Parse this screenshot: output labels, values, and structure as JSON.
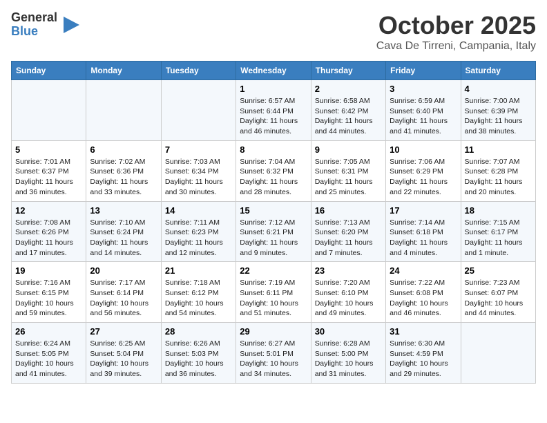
{
  "header": {
    "logo_general": "General",
    "logo_blue": "Blue",
    "month_title": "October 2025",
    "location": "Cava De Tirreni, Campania, Italy"
  },
  "columns": [
    "Sunday",
    "Monday",
    "Tuesday",
    "Wednesday",
    "Thursday",
    "Friday",
    "Saturday"
  ],
  "weeks": [
    [
      {
        "day": "",
        "info": ""
      },
      {
        "day": "",
        "info": ""
      },
      {
        "day": "",
        "info": ""
      },
      {
        "day": "1",
        "info": "Sunrise: 6:57 AM\nSunset: 6:44 PM\nDaylight: 11 hours and 46 minutes."
      },
      {
        "day": "2",
        "info": "Sunrise: 6:58 AM\nSunset: 6:42 PM\nDaylight: 11 hours and 44 minutes."
      },
      {
        "day": "3",
        "info": "Sunrise: 6:59 AM\nSunset: 6:40 PM\nDaylight: 11 hours and 41 minutes."
      },
      {
        "day": "4",
        "info": "Sunrise: 7:00 AM\nSunset: 6:39 PM\nDaylight: 11 hours and 38 minutes."
      }
    ],
    [
      {
        "day": "5",
        "info": "Sunrise: 7:01 AM\nSunset: 6:37 PM\nDaylight: 11 hours and 36 minutes."
      },
      {
        "day": "6",
        "info": "Sunrise: 7:02 AM\nSunset: 6:36 PM\nDaylight: 11 hours and 33 minutes."
      },
      {
        "day": "7",
        "info": "Sunrise: 7:03 AM\nSunset: 6:34 PM\nDaylight: 11 hours and 30 minutes."
      },
      {
        "day": "8",
        "info": "Sunrise: 7:04 AM\nSunset: 6:32 PM\nDaylight: 11 hours and 28 minutes."
      },
      {
        "day": "9",
        "info": "Sunrise: 7:05 AM\nSunset: 6:31 PM\nDaylight: 11 hours and 25 minutes."
      },
      {
        "day": "10",
        "info": "Sunrise: 7:06 AM\nSunset: 6:29 PM\nDaylight: 11 hours and 22 minutes."
      },
      {
        "day": "11",
        "info": "Sunrise: 7:07 AM\nSunset: 6:28 PM\nDaylight: 11 hours and 20 minutes."
      }
    ],
    [
      {
        "day": "12",
        "info": "Sunrise: 7:08 AM\nSunset: 6:26 PM\nDaylight: 11 hours and 17 minutes."
      },
      {
        "day": "13",
        "info": "Sunrise: 7:10 AM\nSunset: 6:24 PM\nDaylight: 11 hours and 14 minutes."
      },
      {
        "day": "14",
        "info": "Sunrise: 7:11 AM\nSunset: 6:23 PM\nDaylight: 11 hours and 12 minutes."
      },
      {
        "day": "15",
        "info": "Sunrise: 7:12 AM\nSunset: 6:21 PM\nDaylight: 11 hours and 9 minutes."
      },
      {
        "day": "16",
        "info": "Sunrise: 7:13 AM\nSunset: 6:20 PM\nDaylight: 11 hours and 7 minutes."
      },
      {
        "day": "17",
        "info": "Sunrise: 7:14 AM\nSunset: 6:18 PM\nDaylight: 11 hours and 4 minutes."
      },
      {
        "day": "18",
        "info": "Sunrise: 7:15 AM\nSunset: 6:17 PM\nDaylight: 11 hours and 1 minute."
      }
    ],
    [
      {
        "day": "19",
        "info": "Sunrise: 7:16 AM\nSunset: 6:15 PM\nDaylight: 10 hours and 59 minutes."
      },
      {
        "day": "20",
        "info": "Sunrise: 7:17 AM\nSunset: 6:14 PM\nDaylight: 10 hours and 56 minutes."
      },
      {
        "day": "21",
        "info": "Sunrise: 7:18 AM\nSunset: 6:12 PM\nDaylight: 10 hours and 54 minutes."
      },
      {
        "day": "22",
        "info": "Sunrise: 7:19 AM\nSunset: 6:11 PM\nDaylight: 10 hours and 51 minutes."
      },
      {
        "day": "23",
        "info": "Sunrise: 7:20 AM\nSunset: 6:10 PM\nDaylight: 10 hours and 49 minutes."
      },
      {
        "day": "24",
        "info": "Sunrise: 7:22 AM\nSunset: 6:08 PM\nDaylight: 10 hours and 46 minutes."
      },
      {
        "day": "25",
        "info": "Sunrise: 7:23 AM\nSunset: 6:07 PM\nDaylight: 10 hours and 44 minutes."
      }
    ],
    [
      {
        "day": "26",
        "info": "Sunrise: 6:24 AM\nSunset: 5:05 PM\nDaylight: 10 hours and 41 minutes."
      },
      {
        "day": "27",
        "info": "Sunrise: 6:25 AM\nSunset: 5:04 PM\nDaylight: 10 hours and 39 minutes."
      },
      {
        "day": "28",
        "info": "Sunrise: 6:26 AM\nSunset: 5:03 PM\nDaylight: 10 hours and 36 minutes."
      },
      {
        "day": "29",
        "info": "Sunrise: 6:27 AM\nSunset: 5:01 PM\nDaylight: 10 hours and 34 minutes."
      },
      {
        "day": "30",
        "info": "Sunrise: 6:28 AM\nSunset: 5:00 PM\nDaylight: 10 hours and 31 minutes."
      },
      {
        "day": "31",
        "info": "Sunrise: 6:30 AM\nSunset: 4:59 PM\nDaylight: 10 hours and 29 minutes."
      },
      {
        "day": "",
        "info": ""
      }
    ]
  ]
}
